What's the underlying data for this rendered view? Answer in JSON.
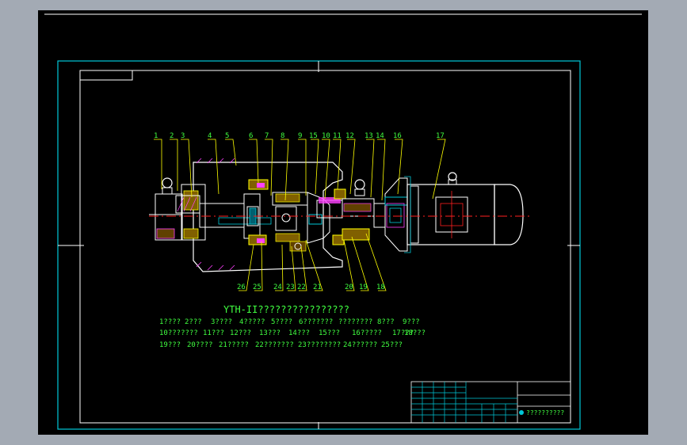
{
  "drawing": {
    "title": "YTH-II????????????????",
    "legend_lines": [
      [
        "1????",
        "2???",
        "3????",
        "4?????",
        "5????",
        "6???????",
        "????????",
        "8???",
        "9???"
      ],
      [
        "10???????",
        "11???",
        "12???",
        "13???",
        "14???",
        "15???",
        "16?????",
        "17???",
        "18???"
      ],
      [
        "19???",
        "20????",
        "21?????",
        "22???????",
        "23????????",
        "24??????",
        "25???"
      ]
    ],
    "callouts_top": [
      "1",
      "2",
      "3",
      "4",
      "5",
      "6",
      "7",
      "8",
      "9",
      "15",
      "10",
      "11",
      "12",
      "13",
      "14",
      "16",
      "17"
    ],
    "callouts_bottom": [
      "26",
      "25",
      "24",
      "23",
      "22",
      "21",
      "20",
      "19",
      "18"
    ],
    "title_block_text": "??????????"
  },
  "colors": {
    "background": "#000000",
    "frame_cyan": "#00c8d8",
    "frame_white": "#ffffff",
    "label_green": "#40ff40",
    "leader_yellow": "#ffff00",
    "centerline_red": "#ff2020",
    "part_magenta": "#ff40ff",
    "motor_white": "#ffffff",
    "outer_gray": "#a3aab4"
  }
}
